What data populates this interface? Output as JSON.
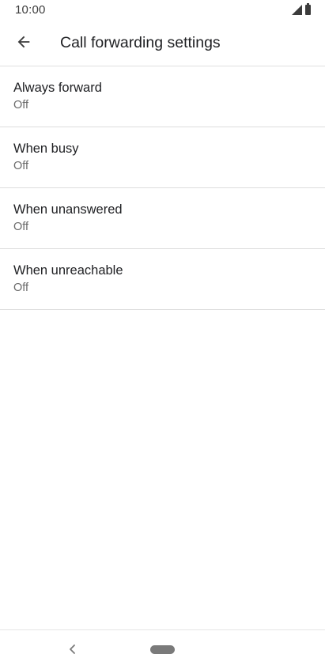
{
  "status_bar": {
    "time": "10:00",
    "icons": [
      "cellular-signal-icon",
      "battery-icon"
    ]
  },
  "app_bar": {
    "back_icon": "arrow-back-icon",
    "title": "Call forwarding settings"
  },
  "settings": {
    "items": [
      {
        "title": "Always forward",
        "summary": "Off"
      },
      {
        "title": "When busy",
        "summary": "Off"
      },
      {
        "title": "When unanswered",
        "summary": "Off"
      },
      {
        "title": "When unreachable",
        "summary": "Off"
      }
    ]
  },
  "nav_bar": {
    "back_icon": "chevron-left-icon",
    "home_icon": "home-pill-icon"
  },
  "colors": {
    "background": "#ffffff",
    "text_primary": "#202124",
    "text_secondary": "#6a6a6a",
    "divider": "#dcdcdc"
  }
}
